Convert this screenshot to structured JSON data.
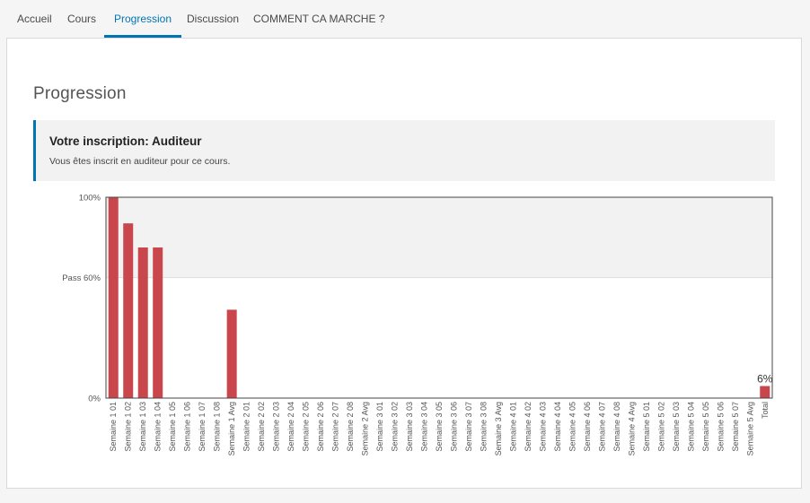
{
  "tabs": [
    {
      "label": "Accueil",
      "active": false
    },
    {
      "label": "Cours",
      "active": false
    },
    {
      "label": "Progression",
      "active": true
    },
    {
      "label": "Discussion",
      "active": false
    },
    {
      "label": "COMMENT CA MARCHE ?",
      "active": false
    }
  ],
  "page_title": "Progression",
  "notice": {
    "title": "Votre inscription: Auditeur",
    "text": "Vous êtes inscrit en auditeur pour ce cours."
  },
  "colors": {
    "accent": "#0075b4",
    "bar": "#c9464c",
    "pass_band": "#f2f2f2"
  },
  "chart_data": {
    "type": "bar",
    "ylim": [
      0,
      100
    ],
    "yticks": [
      {
        "value": 0,
        "label": "0%"
      },
      {
        "value": 60,
        "label": "Pass 60%"
      },
      {
        "value": 100,
        "label": "100%"
      }
    ],
    "pass_threshold": 60,
    "categories": [
      "Semaine 1 01",
      "Semaine 1 02",
      "Semaine 1 03",
      "Semaine 1 04",
      "Semaine 1 05",
      "Semaine 1 06",
      "Semaine 1 07",
      "Semaine 1 08",
      "Semaine 1 Avg",
      "Semaine 2 01",
      "Semaine 2 02",
      "Semaine 2 03",
      "Semaine 2 04",
      "Semaine 2 05",
      "Semaine 2 06",
      "Semaine 2 07",
      "Semaine 2 08",
      "Semaine 2 Avg",
      "Semaine 3 01",
      "Semaine 3 02",
      "Semaine 3 03",
      "Semaine 3 04",
      "Semaine 3 05",
      "Semaine 3 06",
      "Semaine 3 07",
      "Semaine 3 08",
      "Semaine 3 Avg",
      "Semaine 4 01",
      "Semaine 4 02",
      "Semaine 4 03",
      "Semaine 4 04",
      "Semaine 4 05",
      "Semaine 4 06",
      "Semaine 4 07",
      "Semaine 4 08",
      "Semaine 4 Avg",
      "Semaine 5 01",
      "Semaine 5 02",
      "Semaine 5 03",
      "Semaine 5 04",
      "Semaine 5 05",
      "Semaine 5 06",
      "Semaine 5 07",
      "Semaine 5 Avg",
      "Total"
    ],
    "values": [
      100,
      87,
      75,
      75,
      0,
      0,
      0,
      0,
      44,
      0,
      0,
      0,
      0,
      0,
      0,
      0,
      0,
      0,
      0,
      0,
      0,
      0,
      0,
      0,
      0,
      0,
      0,
      0,
      0,
      0,
      0,
      0,
      0,
      0,
      0,
      0,
      0,
      0,
      0,
      0,
      0,
      0,
      0,
      0,
      6
    ],
    "data_labels": [
      {
        "category": "Total",
        "text": "6%"
      }
    ]
  }
}
